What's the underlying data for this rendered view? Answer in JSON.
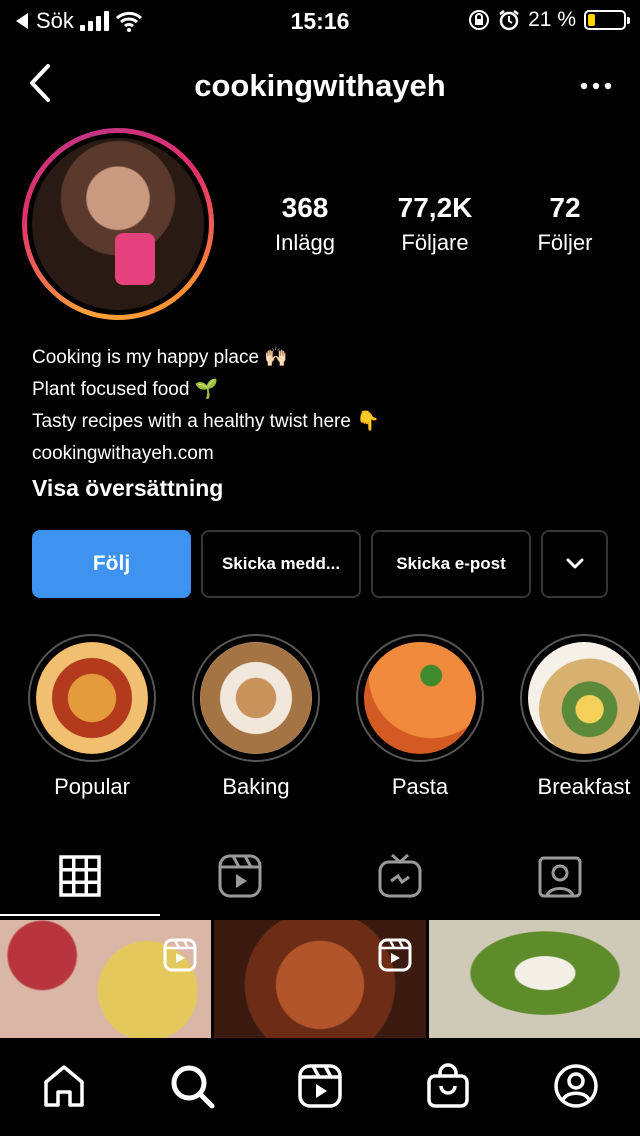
{
  "status_bar": {
    "back_app": "Sök",
    "time": "15:16",
    "battery": "21 %"
  },
  "header": {
    "username": "cookingwithayeh"
  },
  "stats": [
    {
      "value": "368",
      "label": "Inlägg"
    },
    {
      "value": "77,2K",
      "label": "Följare"
    },
    {
      "value": "72",
      "label": "Följer"
    }
  ],
  "bio": {
    "line1": "Cooking is my happy place 🙌🏻",
    "line2": "Plant focused food 🌱",
    "line3": "Tasty recipes with a healthy twist here 👇",
    "link": "cookingwithayeh.com",
    "translate": "Visa översättning"
  },
  "actions": {
    "follow": "Följ",
    "message": "Skicka medd...",
    "email": "Skicka e-post"
  },
  "highlights": [
    {
      "label": "Popular"
    },
    {
      "label": "Baking"
    },
    {
      "label": "Pasta"
    },
    {
      "label": "Breakfast"
    }
  ],
  "colors": {
    "follow_button": "#3e92f0",
    "background": "#000000",
    "battery_fill": "#ffd400"
  }
}
